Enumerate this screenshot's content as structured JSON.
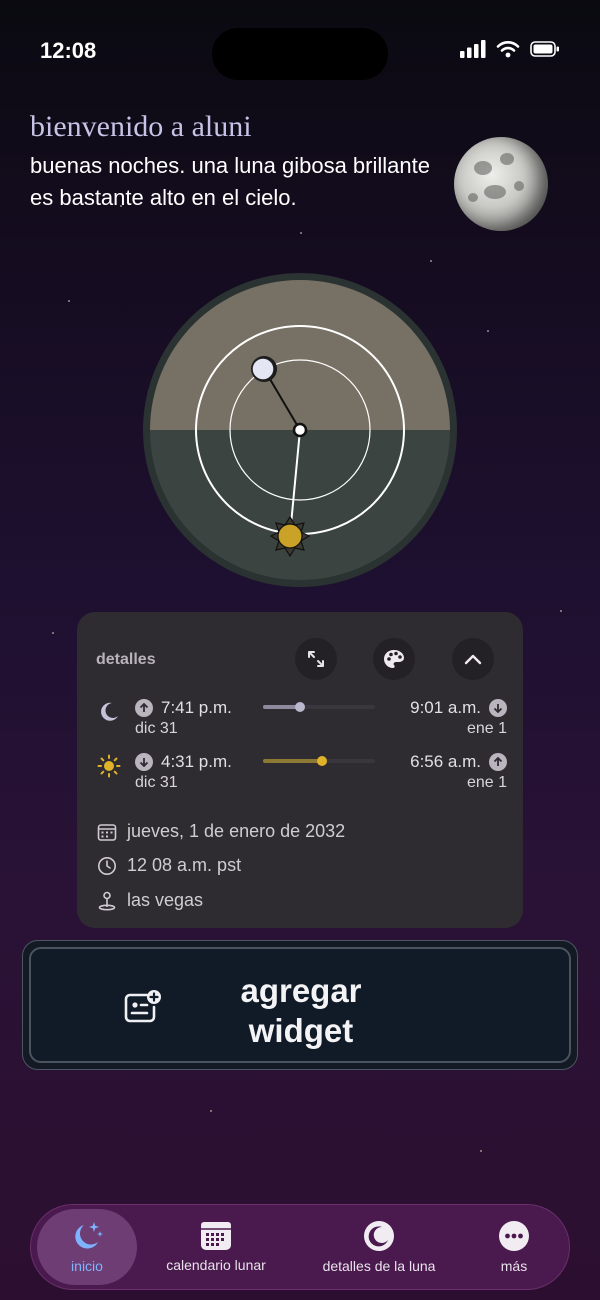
{
  "status_bar": {
    "time": "12:08"
  },
  "header": {
    "title": "bienvenido a aluni",
    "subtitle": "buenas noches. una luna gibosa brillante es bastante alto en el cielo."
  },
  "details": {
    "label": "detalles",
    "moon": {
      "rise_time": "7:41 p.m.",
      "rise_date": "dic 31",
      "set_time": "9:01 a.m.",
      "set_date": "ene 1",
      "progress": 0.33
    },
    "sun": {
      "set_time": "4:31 p.m.",
      "set_date": "dic 31",
      "rise_time": "6:56 a.m.",
      "rise_date": "ene 1",
      "progress": 0.53
    },
    "date": "jueves, 1 de enero de 2032",
    "time": "12 08 a.m. pst",
    "location": "las vegas"
  },
  "widget_button": {
    "line1": "agregar",
    "line2": "widget"
  },
  "tab_bar": {
    "items": [
      {
        "label": "inicio",
        "icon": "moon-stars-icon"
      },
      {
        "label": "calendario lunar",
        "icon": "calendar-icon"
      },
      {
        "label": "detalles de la luna",
        "icon": "moon-icon"
      },
      {
        "label": "más",
        "icon": "more-icon"
      }
    ]
  },
  "colors": {
    "accent": "#7fb3ff",
    "sun": "#c9a227",
    "sky_above": "#777064",
    "sky_below": "#3b4441",
    "tab_bar": "#4a1a4e"
  }
}
